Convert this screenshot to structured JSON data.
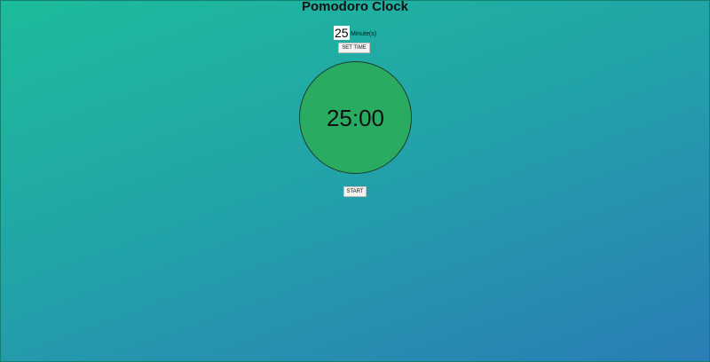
{
  "app": {
    "title": "Pomodoro Clock"
  },
  "settings": {
    "minutes_value": "25",
    "minutes_unit": "Minute(s)",
    "set_time_label": "SET TIME"
  },
  "timer": {
    "display": "25:00",
    "face_color": "#29ac61"
  },
  "controls": {
    "start_label": "START"
  },
  "theme": {
    "gradient_start": "#1cbc9a",
    "gradient_end": "#2a7db6"
  }
}
